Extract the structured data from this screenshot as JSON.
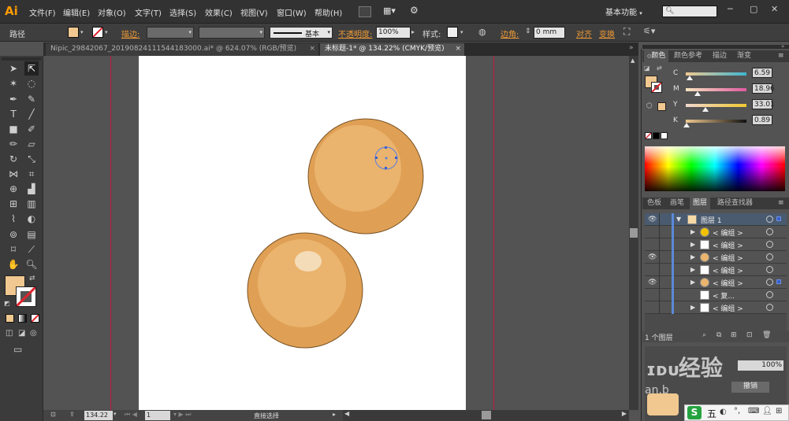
{
  "app": {
    "logo": "Ai",
    "workspace": "基本功能"
  },
  "menu": [
    "文件(F)",
    "编辑(E)",
    "对象(O)",
    "文字(T)",
    "选择(S)",
    "效果(C)",
    "视图(V)",
    "窗口(W)",
    "帮助(H)"
  ],
  "control_bar": {
    "selection_label": "路径",
    "stroke_label": "描边:",
    "stroke_style": "基本",
    "opacity_label": "不透明度:",
    "opacity_value": "100%",
    "style_label": "样式:",
    "corner_label": "边角:",
    "corner_value": "0 mm",
    "align_label": "对齐",
    "transform_label": "变换"
  },
  "tabs": [
    {
      "label": "Nipic_29842067_20190824111544183000.ai* @ 624.07% (RGB/预览)",
      "active": false
    },
    {
      "label": "未标题-1* @ 134.22% (CMYK/预览)",
      "active": true
    }
  ],
  "color_panel": {
    "tabs": [
      "颜色",
      "颜色参考",
      "描边",
      "渐变"
    ],
    "sliders": [
      {
        "label": "C",
        "value": "6.59",
        "fraction": 0.066
      },
      {
        "label": "M",
        "value": "18.96",
        "fraction": 0.19
      },
      {
        "label": "Y",
        "value": "33.01",
        "fraction": 0.33
      },
      {
        "label": "K",
        "value": "0.89",
        "fraction": 0.009
      }
    ]
  },
  "layers_panel": {
    "tabs": [
      "色板",
      "画笔",
      "图层",
      "路径查找器"
    ],
    "layer_name": "图层 1",
    "sublayers": [
      "< 编组 >",
      "< 编组 >",
      "< 编组 >",
      "< 编组 >",
      "< 编组 >",
      "< 复...",
      "< 编组 >"
    ],
    "footer": "1 个图层"
  },
  "status": {
    "zoom": "134.22",
    "page": "1",
    "tool": "直接选择"
  },
  "watermark": {
    "text1": "经验",
    "text2": "an.b",
    "extra": "撤销"
  },
  "ime": "五",
  "colors": {
    "fill": "#f0c890",
    "orange_dark": "#dfa055",
    "orange_mid": "#eab46e",
    "highlight": "#f5dcb8",
    "guide": "#c21a3d"
  }
}
